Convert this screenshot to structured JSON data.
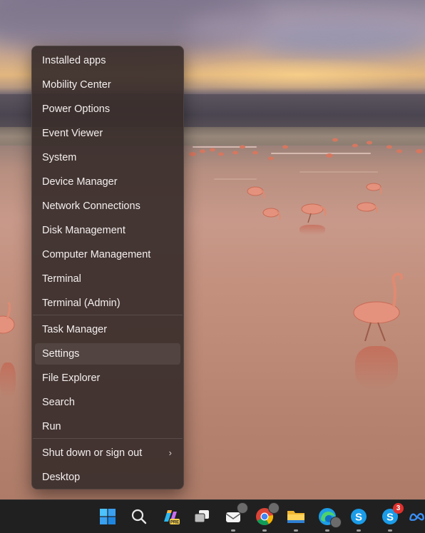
{
  "context_menu": {
    "items": [
      {
        "label": "Installed apps"
      },
      {
        "label": "Mobility Center"
      },
      {
        "label": "Power Options"
      },
      {
        "label": "Event Viewer"
      },
      {
        "label": "System"
      },
      {
        "label": "Device Manager"
      },
      {
        "label": "Network Connections"
      },
      {
        "label": "Disk Management"
      },
      {
        "label": "Computer Management"
      },
      {
        "label": "Terminal"
      },
      {
        "label": "Terminal (Admin)"
      },
      {
        "label": "Task Manager"
      },
      {
        "label": "Settings"
      },
      {
        "label": "File Explorer"
      },
      {
        "label": "Search"
      },
      {
        "label": "Run"
      },
      {
        "label": "Shut down or sign out"
      },
      {
        "label": "Desktop"
      }
    ],
    "highlighted_item": "Settings",
    "submenu_chevron": "›"
  },
  "taskbar": {
    "icons": [
      {
        "name": "windows-start-icon"
      },
      {
        "name": "search-icon"
      },
      {
        "name": "copilot-pre-icon",
        "badge_text": "PRE"
      },
      {
        "name": "task-view-icon"
      },
      {
        "name": "mail-icon"
      },
      {
        "name": "chrome-icon"
      },
      {
        "name": "file-explorer-icon"
      },
      {
        "name": "edge-icon"
      },
      {
        "name": "skype-icon"
      },
      {
        "name": "skype-insider-icon",
        "badge": "3"
      },
      {
        "name": "meta-icon"
      }
    ]
  },
  "colors": {
    "menu_bg": "#3a2e2c",
    "taskbar_bg": "#202020",
    "badge": "#e0302d",
    "windows_blue": "#3b9cf0"
  }
}
